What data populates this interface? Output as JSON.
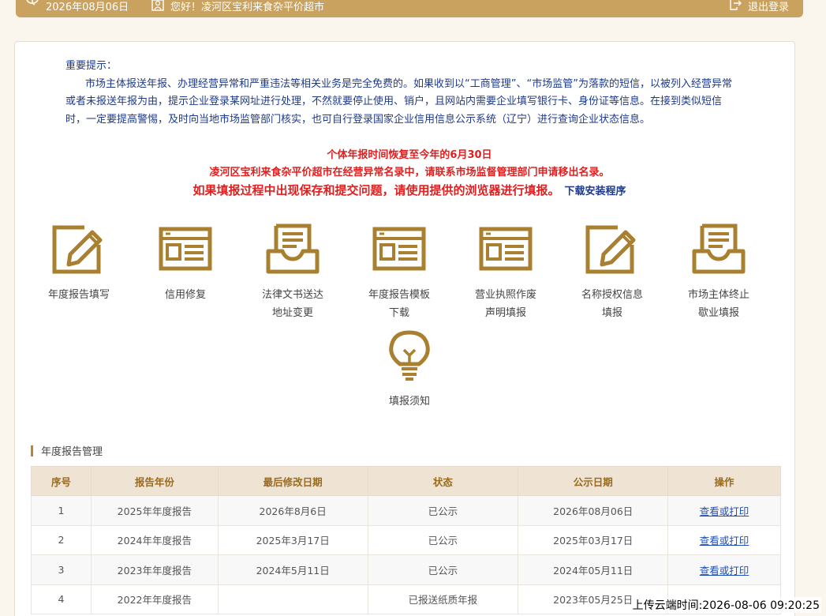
{
  "header": {
    "date": "2026年08月06日",
    "greeting": "您好！凌河区宝利来食杂平价超市",
    "logout": "退出登录",
    "icons": [
      "clock-icon",
      "user-icon",
      "logout-icon"
    ]
  },
  "notice": {
    "heading": "重要提示：",
    "paragraph": "市场主体报送年报、办理经营异常和严重违法等相关业务是完全免费的。如果收到以“工商管理”、“市场监管”为落款的短信，以被列入经营异常或者未报送年报为由，提示企业登录某网址进行处理，不然就要停止使用、销户，且网站内需要企业填写银行卡、身份证等信息。在接到类似短信时，一定要提高警惕，及时向当地市场监管部门核实，也可自行登录国家企业信用信息公示系统（辽宁）进行查询企业状态信息。",
    "alert1": "个体年报时间恢复至今年的6月30日",
    "alert2": "凌河区宝利来食杂平价超市在经营异常名录中，请联系市场监督管理部门申请移出名录。",
    "alert3": "如果填报过程中出现保存和提交问题，请使用提供的浏览器进行填报。",
    "download_link": "下载安装程序"
  },
  "tiles": [
    {
      "line1": "年度报告填写",
      "line2": "",
      "icon": "edit-icon"
    },
    {
      "line1": "信用修复",
      "line2": "",
      "icon": "form-icon"
    },
    {
      "line1": "法律文书送达",
      "line2": "地址变更",
      "icon": "inbox-icon"
    },
    {
      "line1": "年度报告模板",
      "line2": "下载",
      "icon": "form-icon"
    },
    {
      "line1": "营业执照作废",
      "line2": "声明填报",
      "icon": "form-icon"
    },
    {
      "line1": "名称授权信息",
      "line2": "填报",
      "icon": "edit-icon"
    },
    {
      "line1": "市场主体终止",
      "line2": "歇业填报",
      "icon": "inbox-icon"
    },
    {
      "line1": "填报须知",
      "line2": "",
      "icon": "lightbulb-icon"
    }
  ],
  "section_title": "年度报告管理",
  "table": {
    "headers": [
      "序号",
      "报告年份",
      "最后修改日期",
      "状态",
      "公示日期",
      "操作"
    ],
    "rows": [
      [
        "1",
        "2025年年度报告",
        "2026年8月6日",
        "已公示",
        "2026年08月06日",
        "查看或打印"
      ],
      [
        "2",
        "2024年年度报告",
        "2025年3月17日",
        "已公示",
        "2025年03月17日",
        "查看或打印"
      ],
      [
        "3",
        "2023年年度报告",
        "2024年5月11日",
        "已公示",
        "2024年05月11日",
        "查看或打印"
      ],
      [
        "4",
        "2022年年度报告",
        "",
        "已报送纸质年报",
        "2023年05月25日",
        ""
      ]
    ]
  },
  "upload_time": "上传云端时间:2026-08-06 09:20:25",
  "colors": {
    "gold": "#c9a25f",
    "red": "#e02020",
    "blue": "#1f3a8a",
    "icon_gold": "#a8802f"
  }
}
